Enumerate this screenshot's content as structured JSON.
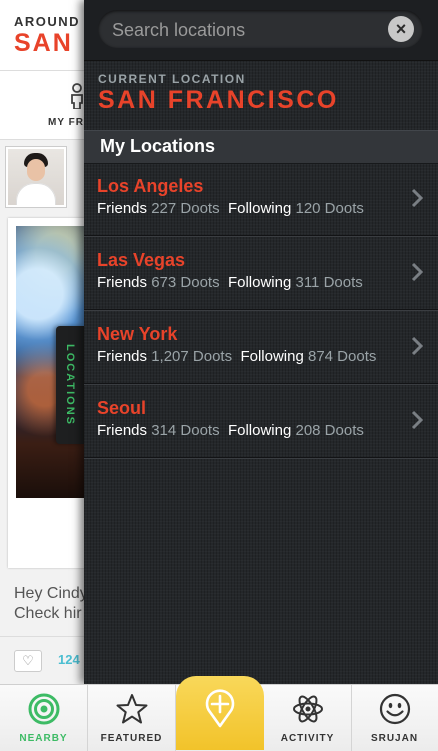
{
  "background": {
    "header_title": "AROUND",
    "header_city": "SAN",
    "nav_label": "MY FR",
    "post_text": [
      "Hey Cindy",
      "Check hir"
    ],
    "like_count": "124"
  },
  "side_tab": {
    "label": "LOCATIONS"
  },
  "search": {
    "placeholder": "Search locations",
    "clear_label": "×"
  },
  "current_location": {
    "label": "CURRENT LOCATION",
    "city": "SAN FRANCISCO"
  },
  "section": {
    "title": "My Locations"
  },
  "locations": [
    {
      "name": "Los Angeles",
      "friends_label": "Friends",
      "friends_count": "227 Doots",
      "following_label": "Following",
      "following_count": "120 Doots"
    },
    {
      "name": "Las Vegas",
      "friends_label": "Friends",
      "friends_count": "673 Doots",
      "following_label": "Following",
      "following_count": "311 Doots"
    },
    {
      "name": "New York",
      "friends_label": "Friends",
      "friends_count": "1,207 Doots",
      "following_label": "Following",
      "following_count": "874 Doots"
    },
    {
      "name": "Seoul",
      "friends_label": "Friends",
      "friends_count": "314 Doots",
      "following_label": "Following",
      "following_count": "208 Doots"
    }
  ],
  "tabs": [
    {
      "label": "NEARBY",
      "icon": "target-icon",
      "active": true
    },
    {
      "label": "FEATURED",
      "icon": "star-icon"
    },
    {
      "label": "",
      "icon": "map-pin-plus-icon"
    },
    {
      "label": "ACTIVITY",
      "icon": "atom-icon"
    },
    {
      "label": "SRUJAN",
      "icon": "smiley-icon"
    }
  ],
  "colors": {
    "accent": "#e8432a",
    "active_tab": "#3dbb65",
    "stat_number": "#9aa3a7",
    "center_tab": "#f2c32a"
  }
}
